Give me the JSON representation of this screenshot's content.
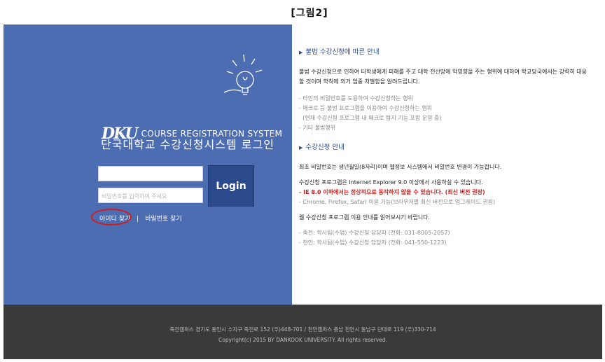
{
  "caption": "[그림2]",
  "login_panel": {
    "bulb_icon": "lightbulb-icon",
    "logo_text": "DKU",
    "system_name": "COURSE REGISTRATION SYSTEM",
    "title": "단국대학교 수강신청시스템 로그인",
    "id_value": "",
    "pw_placeholder": "비밀번호를 입력하여 주세요",
    "login_label": "Login",
    "find_id": "아이디 찾기",
    "separator": "|",
    "find_pw": "비밀번호 찾기",
    "highlight_color": "#d21c1c"
  },
  "notice": {
    "section1_title": "불법 수강신청에 따른 안내",
    "section1_para": "불법 수강신청으로 인하여 타학생에게 피해를 주고 대학 전산망에 악영향을 주는 행위에 대하여 학교당국에서는 강력히 대응 할 것이며 학칙에 의거 엄중 처벌함을 알려드립니다.",
    "section1_items": [
      "- 타인의 비밀번호를 도용하여 수강신청하는 행위",
      "- 매크로 등 불법 프로그램을 이용하여 수강신청하는 행위",
      "  (현재 수강신청 프로그램 내 매크로 탐지 기능 포함 운영 중)",
      "- 기타 불법행위"
    ],
    "section2_title": "수강신청 안내",
    "line1": "최초 비밀번호는 생년월일(8자리)이며 웹정보 시스템에서 비밀번호 변경이 가능합니다.",
    "line2": "수강신청 프로그램은 Internet Explorer 9.0 이상에서 사용하실 수 있습니다.",
    "line3": "-  IE 8.0 이하에서는 정상적으로 동작하지 않을 수 있습니다. (최신 버전 권장)",
    "line4": "- Chrome, Firefox, Safari 이용 가능(브라우저별 최신 버전으로 업그레이드 권장)",
    "line5": "웹 수강신청 프로그램 이용 안내를 읽어보시기 바랍니다.",
    "contacts": [
      "- 죽전: 학사팀(수업) 수강신청 담당자 (전화: 031-8005-2057)",
      "- 천안: 학사팀(수업) 수강신청 담당자 (전화: 041-550-1223)"
    ]
  },
  "footer": {
    "address": "죽전캠퍼스 경기도 용인시 수지구 죽전로 152 (우)448-701 / 천안캠퍼스 충남 천안시 동남구 단대로 119 (우)330-714",
    "copyright": "Copyright(c) 2015 BY DANKOOK UNIVERSITY. All rights reserved."
  }
}
